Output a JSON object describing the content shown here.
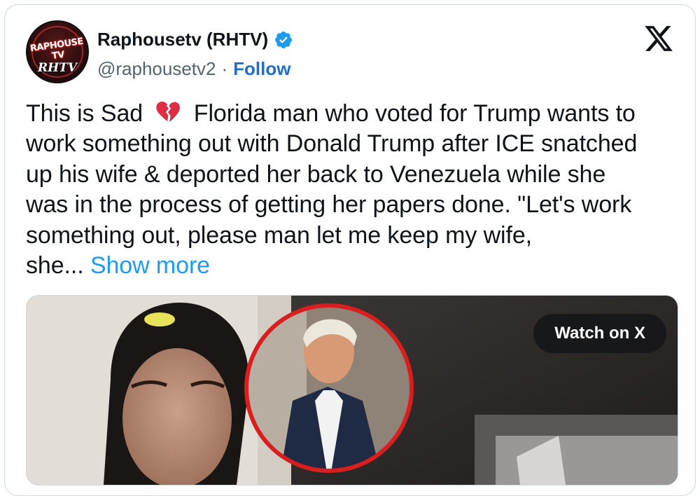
{
  "author": {
    "display_name": "Raphousetv (RHTV)",
    "handle": "@raphousetv2",
    "separator": "·",
    "follow_label": "Follow",
    "verified": true,
    "avatar_logo_top": "RAPHOUSE TV",
    "avatar_logo_bottom": "RHTV"
  },
  "platform_icon": "x-logo-icon",
  "tweet": {
    "lines": [
      {
        "before": "This is Sad",
        "emoji": "broken-heart-icon",
        "after": "Florida man who voted for Trump wants to"
      },
      {
        "text": "work something out with Donald Trump after ICE snatched"
      },
      {
        "text": "up his wife & deported her back to Venezuela while she"
      },
      {
        "text": "was in the process of getting her papers done. \"Let's work"
      },
      {
        "text": "something out, please man let me keep my wife,"
      },
      {
        "text": "she..."
      }
    ],
    "show_more_label": "Show more"
  },
  "media": {
    "watch_label": "Watch on X"
  },
  "colors": {
    "accent_link": "#1d9bf0",
    "follow": "#1d6fc9",
    "verified_badge": "#1d9bf0",
    "border": "#cfd9de",
    "text": "#0f1419",
    "secondary_text": "#536471"
  }
}
